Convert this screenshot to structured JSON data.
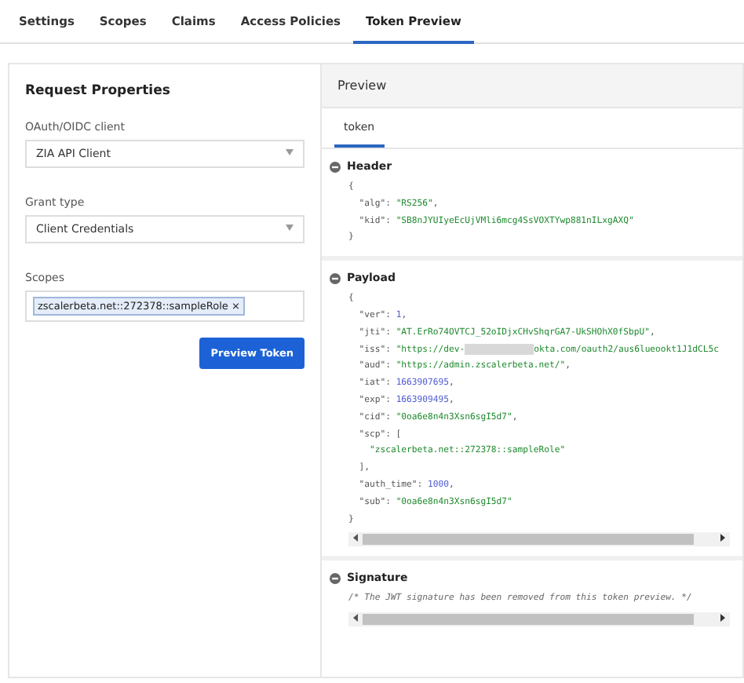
{
  "tabs": [
    {
      "label": "Settings",
      "selected": false
    },
    {
      "label": "Scopes",
      "selected": false
    },
    {
      "label": "Claims",
      "selected": false
    },
    {
      "label": "Access Policies",
      "selected": false
    },
    {
      "label": "Token Preview",
      "selected": true
    }
  ],
  "request": {
    "title": "Request Properties",
    "client": {
      "label": "OAuth/OIDC client",
      "value": "ZIA API Client"
    },
    "grant": {
      "label": "Grant type",
      "value": "Client Credentials"
    },
    "scopes": {
      "label": "Scopes",
      "chips": [
        {
          "text": "zscalerbeta.net::272378::sampleRole",
          "remove": "×"
        }
      ]
    },
    "button": "Preview Token"
  },
  "preview": {
    "title": "Preview",
    "tabs": [
      {
        "label": "token",
        "selected": true
      }
    ],
    "sections": [
      {
        "title": "Header",
        "expanded": true,
        "scrollbar": false,
        "lines": [
          [
            {
              "kind": "punct",
              "text": "{"
            }
          ],
          [
            {
              "kind": "key",
              "text": "  \"alg\": "
            },
            {
              "kind": "string",
              "text": "\"RS256\""
            },
            {
              "kind": "punct",
              "text": ","
            }
          ],
          [
            {
              "kind": "key",
              "text": "  \"kid\": "
            },
            {
              "kind": "string",
              "text": "\"SB8nJYUIyeEcUjVMli6mcg4SsVOXTYwp881nILxgAXQ\""
            }
          ],
          [
            {
              "kind": "punct",
              "text": "}"
            }
          ]
        ]
      },
      {
        "title": "Payload",
        "expanded": true,
        "scrollbar": true,
        "lines": [
          [
            {
              "kind": "punct",
              "text": "{"
            }
          ],
          [
            {
              "kind": "key",
              "text": "  \"ver\": "
            },
            {
              "kind": "number",
              "text": "1"
            },
            {
              "kind": "punct",
              "text": ","
            }
          ],
          [
            {
              "kind": "key",
              "text": "  \"jti\": "
            },
            {
              "kind": "string",
              "text": "\"AT.ErRo74OVTCJ_52oIDjxCHvShqrGA7-UkSHOhX0fSbpU\""
            },
            {
              "kind": "punct",
              "text": ","
            }
          ],
          [
            {
              "kind": "key",
              "text": "  \"iss\": "
            },
            {
              "kind": "string",
              "text": "\"https://dev-"
            },
            {
              "kind": "redacted"
            },
            {
              "kind": "string",
              "text": "okta.com/oauth2/aus6lueookt1J1dCL5c"
            }
          ],
          [
            {
              "kind": "key",
              "text": "  \"aud\": "
            },
            {
              "kind": "string",
              "text": "\"https://admin.zscalerbeta.net/\""
            },
            {
              "kind": "punct",
              "text": ","
            }
          ],
          [
            {
              "kind": "key",
              "text": "  \"iat\": "
            },
            {
              "kind": "number",
              "text": "1663907695"
            },
            {
              "kind": "punct",
              "text": ","
            }
          ],
          [
            {
              "kind": "key",
              "text": "  \"exp\": "
            },
            {
              "kind": "number",
              "text": "1663909495"
            },
            {
              "kind": "punct",
              "text": ","
            }
          ],
          [
            {
              "kind": "key",
              "text": "  \"cid\": "
            },
            {
              "kind": "string",
              "text": "\"0oa6e8n4n3Xsn6sgI5d7\""
            },
            {
              "kind": "punct",
              "text": ","
            }
          ],
          [
            {
              "kind": "key",
              "text": "  \"scp\": ["
            }
          ],
          [
            {
              "kind": "string",
              "text": "    \"zscalerbeta.net::272378::sampleRole\""
            }
          ],
          [
            {
              "kind": "punct",
              "text": "  ],"
            }
          ],
          [
            {
              "kind": "key",
              "text": "  \"auth_time\": "
            },
            {
              "kind": "number",
              "text": "1000"
            },
            {
              "kind": "punct",
              "text": ","
            }
          ],
          [
            {
              "kind": "key",
              "text": "  \"sub\": "
            },
            {
              "kind": "string",
              "text": "\"0oa6e8n4n3Xsn6sgI5d7\""
            }
          ],
          [
            {
              "kind": "punct",
              "text": "}"
            }
          ]
        ]
      },
      {
        "title": "Signature",
        "expanded": true,
        "scrollbar": true,
        "lines": [
          [
            {
              "kind": "comment",
              "text": "/* The JWT signature has been removed from this token preview. */"
            }
          ]
        ]
      }
    ]
  }
}
